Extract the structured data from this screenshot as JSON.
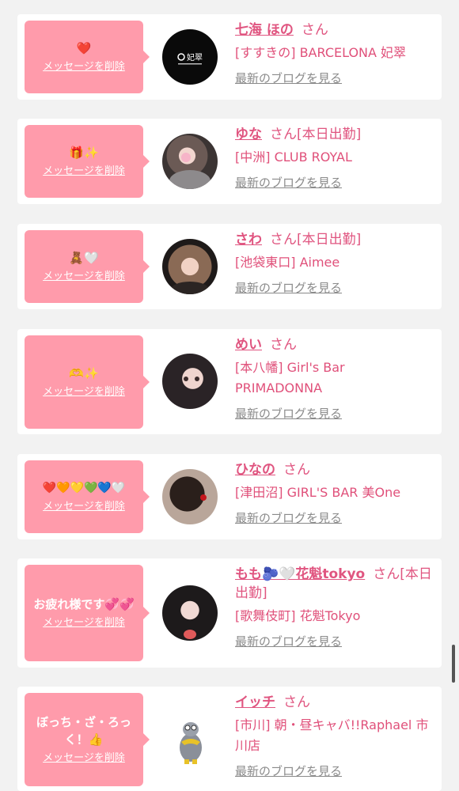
{
  "delete_label": "メッセージを削除",
  "blog_label": "最新のブログを見る",
  "san": "さん",
  "entries": [
    {
      "message": "❤️",
      "name": "七海 ほの",
      "attend": "",
      "shop": "[すすきの] BARCELONA 妃翠",
      "avatar_text": "妃翠"
    },
    {
      "message": "🎁✨",
      "name": "ゆな",
      "attend": "[本日出勤]",
      "shop": "[中洲] CLUB ROYAL",
      "avatar_text": ""
    },
    {
      "message": "🧸🤍",
      "name": "さわ",
      "attend": "[本日出勤]",
      "shop": "[池袋東口] Aimee",
      "avatar_text": ""
    },
    {
      "message": "🫶✨",
      "name": "めい",
      "attend": "",
      "shop": "[本八幡] Girl's Bar PRIMADONNA",
      "avatar_text": ""
    },
    {
      "message": "❤️🧡💛💚💙🤍",
      "name": "ひなの",
      "attend": "",
      "shop": "[津田沼] GIRL'S BAR 美One",
      "avatar_text": ""
    },
    {
      "message": "お疲れ様です💞💞",
      "name": "もも🫐🤍花魁tokyo",
      "attend": "[本日出勤]",
      "shop": "[歌舞伎町] 花魁Tokyo",
      "avatar_text": ""
    },
    {
      "message": "ぼっち・ざ・ろっく！👍",
      "name": "イッチ",
      "attend": "",
      "shop": "[市川] 朝・昼キャバ!!Raphael 市川店",
      "avatar_text": ""
    }
  ]
}
